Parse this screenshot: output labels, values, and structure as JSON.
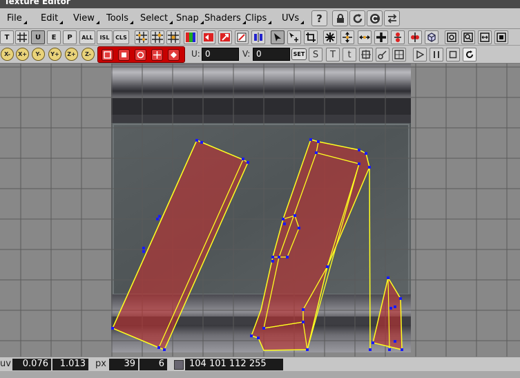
{
  "window": {
    "title": "Texture Editor"
  },
  "menu": {
    "items": [
      "File",
      "Edit",
      "View",
      "Tools",
      "Select",
      "Snap",
      "Shaders",
      "Clips",
      "UVs"
    ],
    "help_label": "?"
  },
  "toolbar_row2": {
    "letter_buttons": [
      "T",
      "U",
      "E",
      "P",
      "ALL",
      "ISL",
      "CLS"
    ]
  },
  "toolbar_row3": {
    "axis_buttons": [
      "X-",
      "X+",
      "Y-",
      "Y+",
      "Z+",
      "Z-"
    ],
    "u_label": "U:",
    "u_value": "0",
    "v_label": "V:",
    "v_value": "0",
    "set_label": "SET",
    "snap_buttons": [
      "S",
      "T",
      "t"
    ]
  },
  "status": {
    "uv_label": "uv",
    "u": "0.076",
    "v": "1.013",
    "px_label": "px",
    "px_x": "39",
    "px_y": "6",
    "color": "104  101  112  255"
  },
  "colors": {
    "uv_fill": "#c03030",
    "uv_edge": "#ffff20",
    "vertex": "#1a1aff",
    "grid": "#5a5a5a"
  }
}
